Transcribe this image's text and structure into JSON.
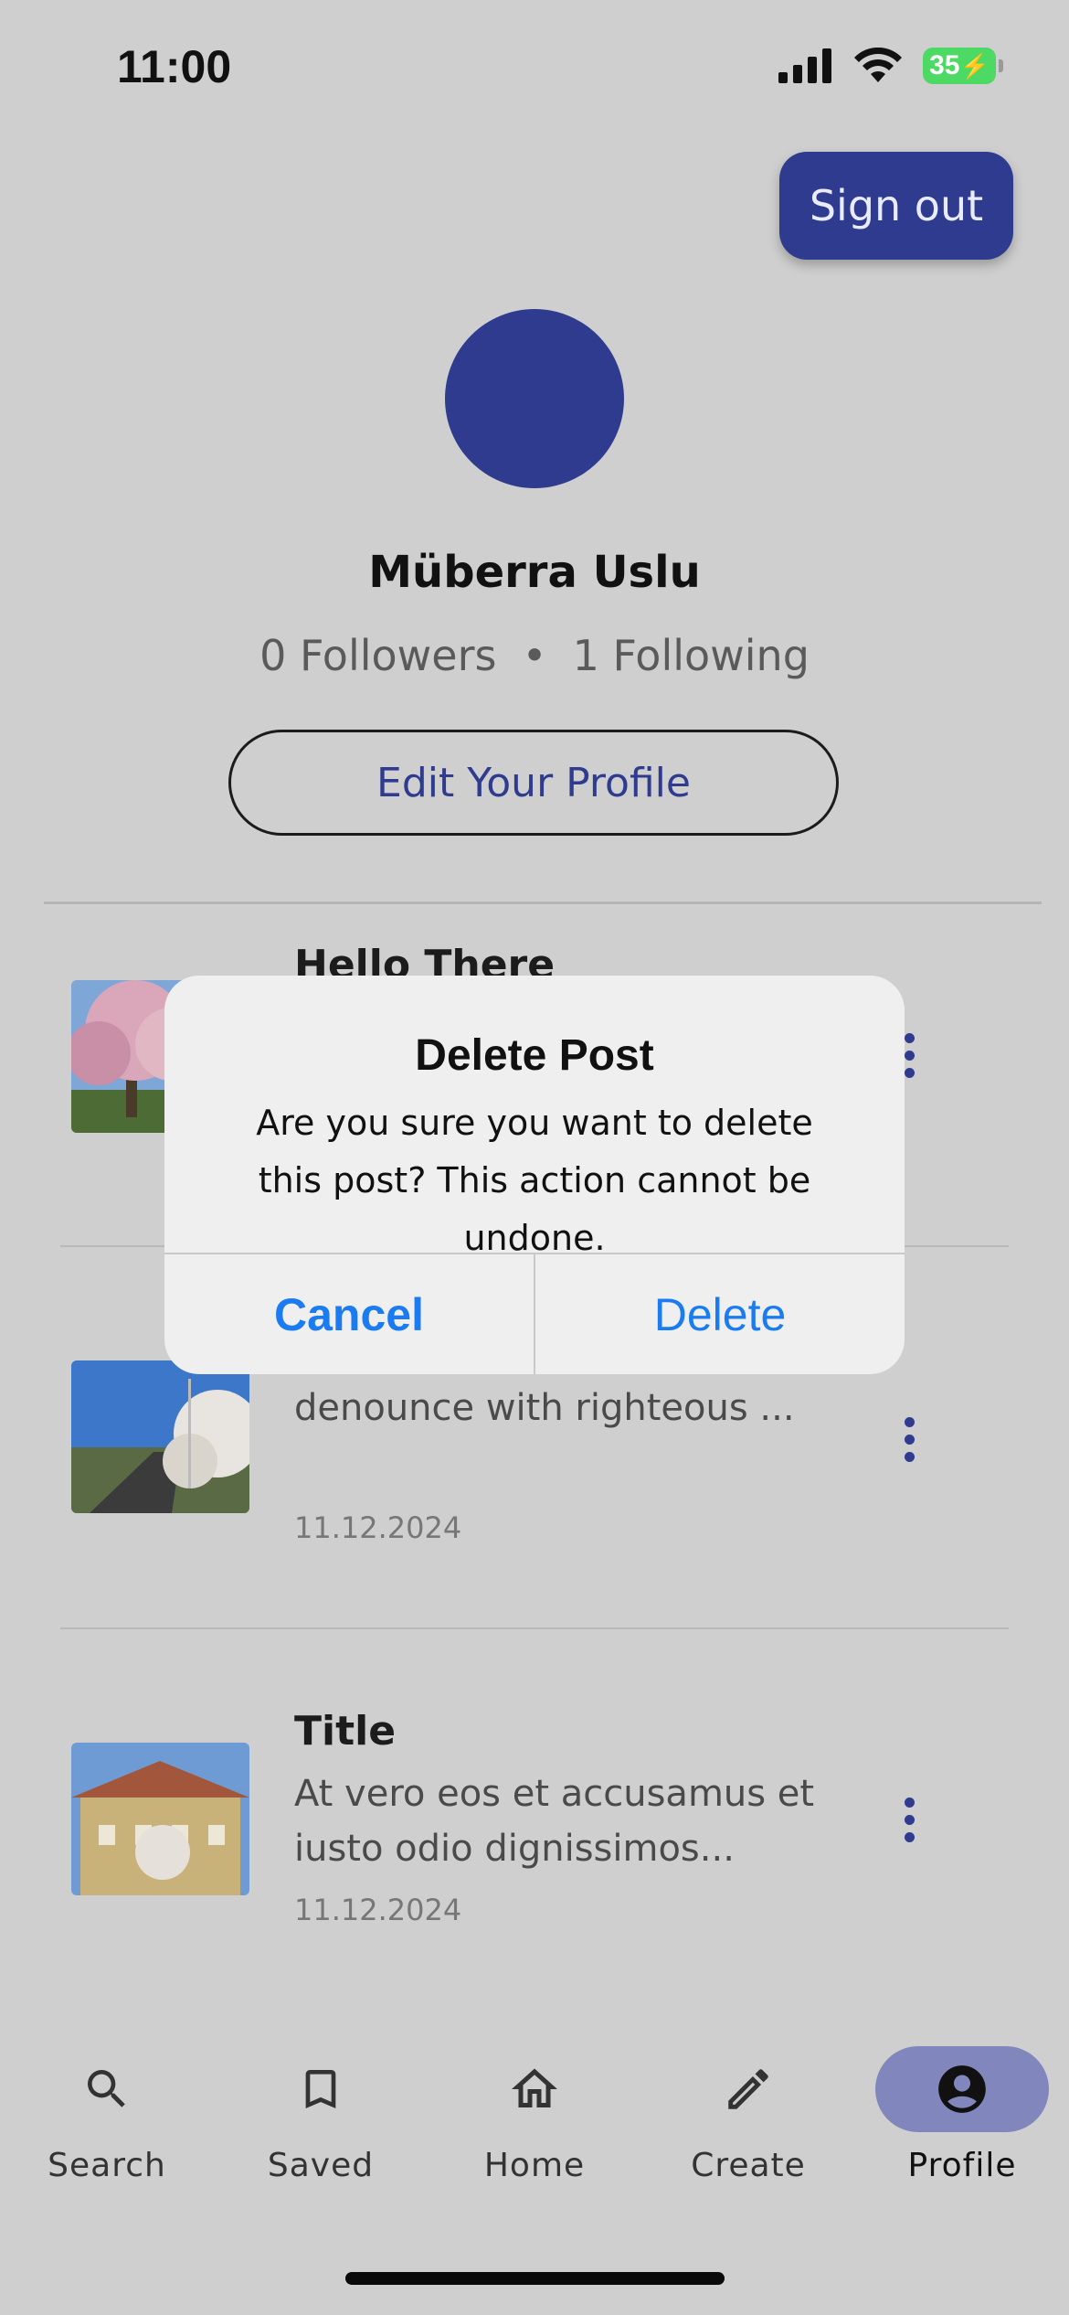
{
  "status": {
    "time": "11:00",
    "battery": "35"
  },
  "header": {
    "sign_out_label": "Sign out"
  },
  "profile": {
    "name": "Müberra Uslu",
    "followers": "0 Followers",
    "separator": "•",
    "following": "1 Following",
    "edit_label": "Edit Your Profile"
  },
  "posts": [
    {
      "title": "Hello There",
      "body": "",
      "date": ""
    },
    {
      "title": "",
      "body": "\"On the other hand, we denounce with righteous ...",
      "date": "11.12.2024"
    },
    {
      "title": "Title",
      "body": "At vero eos et accusamus et iusto odio dignissimos...",
      "date": "11.12.2024"
    }
  ],
  "dialog": {
    "title": "Delete Post",
    "message": "Are you sure you want to delete this post? This action cannot be undone.",
    "cancel_label": "Cancel",
    "delete_label": "Delete"
  },
  "nav": {
    "items": [
      {
        "label": "Search",
        "icon": "search-icon"
      },
      {
        "label": "Saved",
        "icon": "bookmark-icon"
      },
      {
        "label": "Home",
        "icon": "home-icon"
      },
      {
        "label": "Create",
        "icon": "pencil-icon"
      },
      {
        "label": "Profile",
        "icon": "account-circle-icon",
        "active": true
      }
    ]
  },
  "colors": {
    "accent": "#2f3b8f",
    "dialog_button": "#1a7cf0",
    "active_nav": "#8187bd",
    "background": "#cfcfcf"
  }
}
